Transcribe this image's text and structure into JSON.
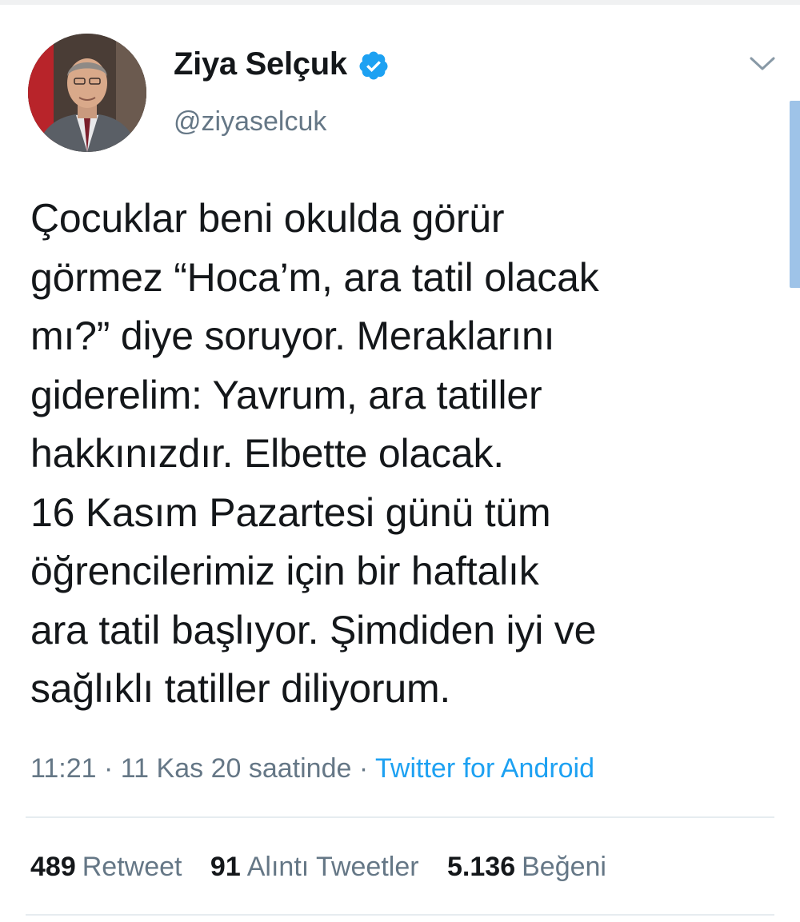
{
  "user": {
    "display_name": "Ziya Selçuk",
    "handle": "@ziyaselcuk",
    "verified": true
  },
  "tweet": {
    "lines": [
      "Çocuklar beni okulda görür",
      "görmez “Hoca’m, ara tatil olacak",
      "mı?” diye soruyor. Meraklarını",
      "giderelim: Yavrum, ara tatiller",
      "hakkınızdır. Elbette olacak.",
      "16 Kasım Pazartesi günü tüm",
      "öğrencilerimiz için bir haftalık",
      "ara tatil başlıyor. Şimdiden iyi ve",
      "sağlıklı tatiller diliyorum."
    ],
    "time": "11:21",
    "date": "11 Kas 20 saatinde",
    "separator": "·",
    "source": "Twitter for Android"
  },
  "stats": {
    "retweets": {
      "count": "489",
      "label": "Retweet"
    },
    "quotes": {
      "count": "91",
      "label": "Alıntı Tweetler"
    },
    "likes": {
      "count": "5.136",
      "label": "Beğeni"
    }
  },
  "icons": {
    "verified": "verified-badge-icon",
    "menu": "chevron-down-icon"
  },
  "colors": {
    "accent": "#1da1f2",
    "text_primary": "#14171a",
    "text_secondary": "#657786",
    "divider": "#e6ecf0"
  }
}
